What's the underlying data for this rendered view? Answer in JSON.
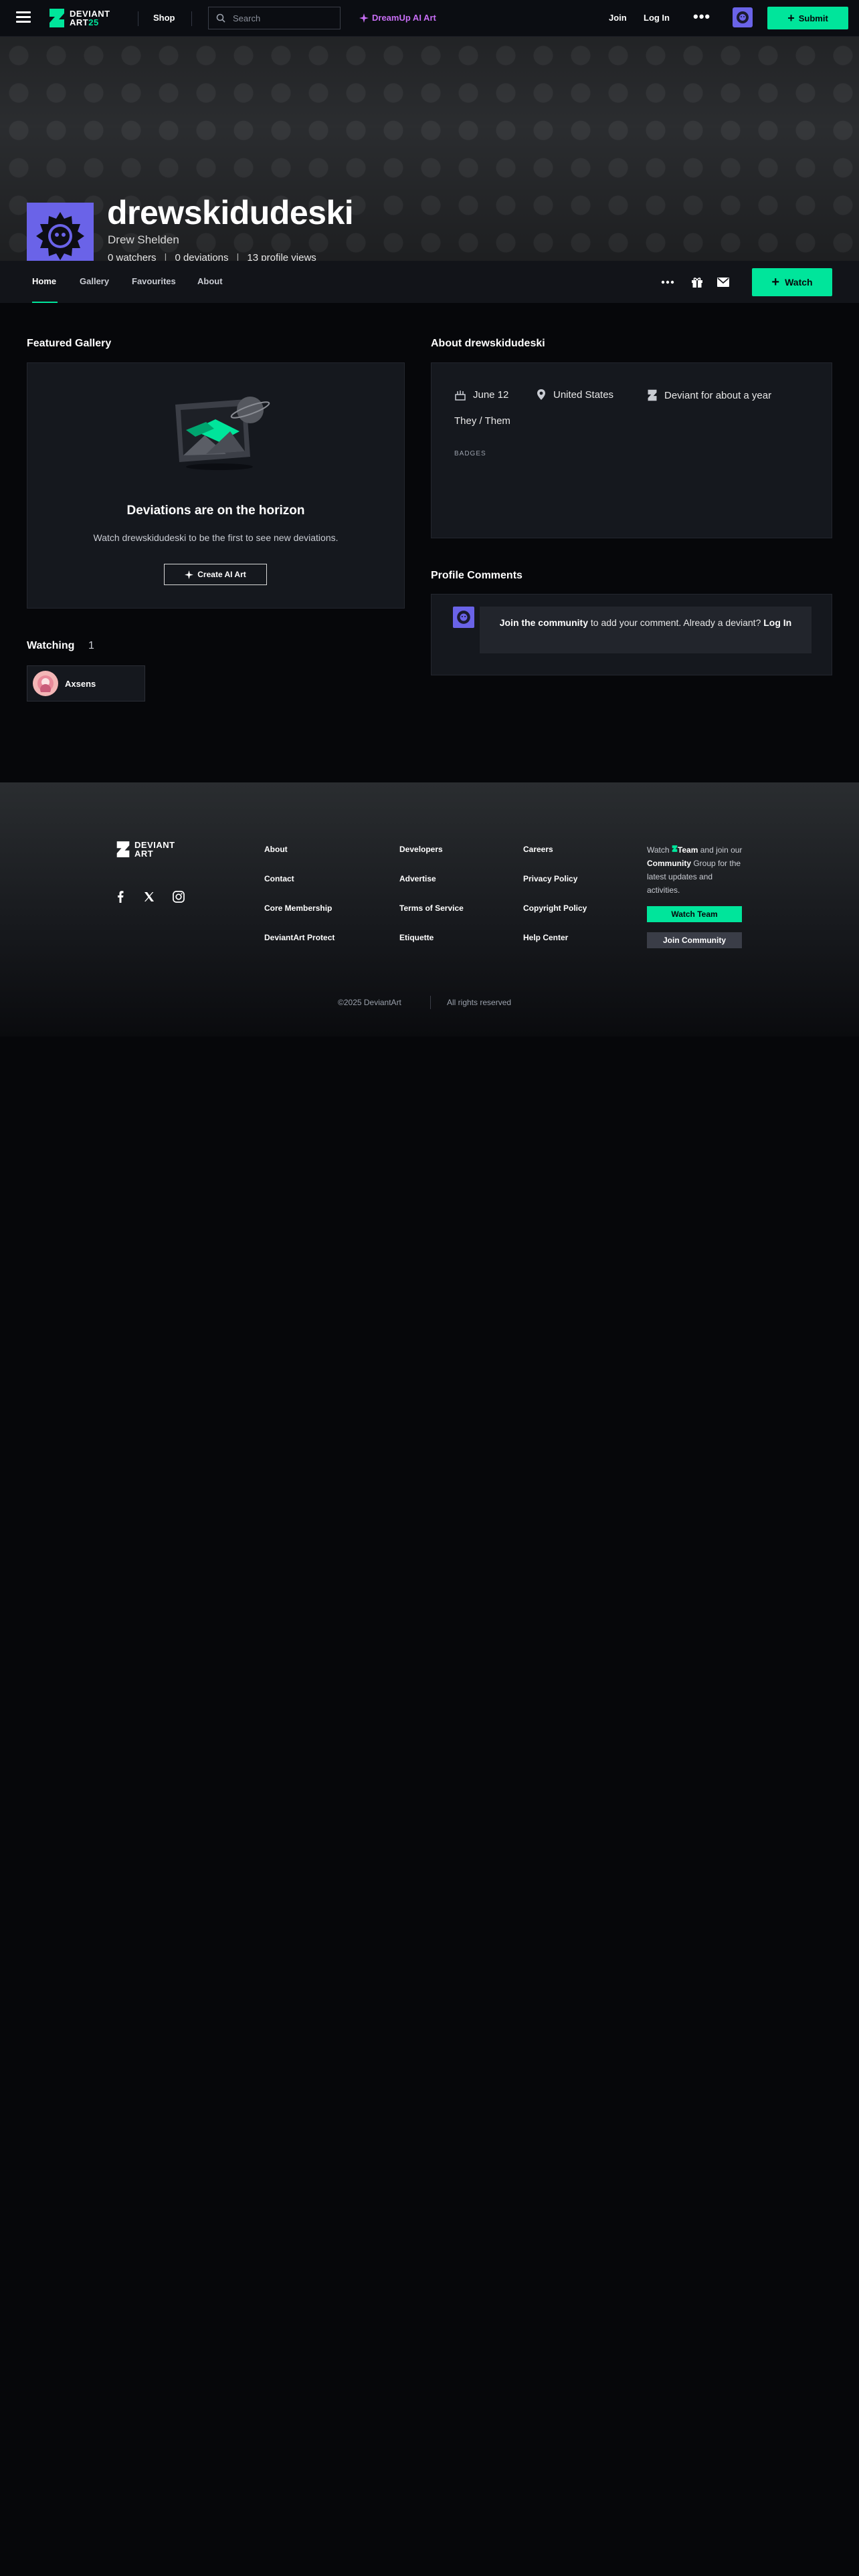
{
  "topbar": {
    "logo_line1": "DEVIANT",
    "logo_line2": "ART",
    "logo_badge": "25",
    "shop": "Shop",
    "search_placeholder": "Search",
    "dreamup": "DreamUp AI Art",
    "join": "Join",
    "login": "Log In",
    "more": "•••",
    "submit": "Submit"
  },
  "profile": {
    "username": "drewskidudeski",
    "realname": "Drew Shelden",
    "watchers": "0 watchers",
    "deviations": "0 deviations",
    "views": "13 profile views",
    "sep": "|"
  },
  "subnav": {
    "tabs": [
      "Home",
      "Gallery",
      "Favourites",
      "About"
    ],
    "active_tab": "Home",
    "watch": "Watch"
  },
  "featured": {
    "title": "Featured Gallery",
    "heading": "Deviations are on the horizon",
    "sub": "Watch drewskidudeski to be the first to see new deviations.",
    "button": "Create AI Art"
  },
  "watching": {
    "title": "Watching",
    "count": "1",
    "items": [
      {
        "name": "Axsens"
      }
    ]
  },
  "about": {
    "title": "About drewskidudeski",
    "birthday": "June 12",
    "location": "United States",
    "member": "Deviant for about a year",
    "pronouns": "They / Them",
    "badges_label": "BADGES"
  },
  "comments": {
    "title": "Profile Comments",
    "join_text": "Join the community",
    "middle_text": " to add your comment. Already a deviant? ",
    "login_text": "Log In"
  },
  "footer": {
    "col1": [
      "About",
      "Contact",
      "Core Membership",
      "DeviantArt Protect"
    ],
    "col2": [
      "Developers",
      "Advertise",
      "Terms of Service",
      "Etiquette"
    ],
    "col3": [
      "Careers",
      "Privacy Policy",
      "Copyright Policy",
      "Help Center"
    ],
    "promo_watch": "Watch",
    "promo_team": "Team",
    "promo_and": "and join our",
    "promo_community": "Community",
    "promo_rest": "Group for the latest updates and activities.",
    "watch_team": "Watch Team",
    "join_community": "Join Community",
    "copyright": "©2025 DeviantArt",
    "rights": "All rights reserved"
  },
  "colors": {
    "accent": "#00e59b",
    "avatar": "#6a63e8",
    "dreamup": "#c86ef5",
    "background": "#06070a"
  },
  "icons": [
    "menu-icon",
    "deviantart-logo-icon",
    "search-icon",
    "sparkle-icon",
    "user-avatar-icon",
    "plus-icon",
    "more-icon",
    "gift-icon",
    "mail-icon",
    "cake-icon",
    "location-pin-icon",
    "deviantart-icon",
    "facebook-icon",
    "x-icon",
    "instagram-icon"
  ]
}
